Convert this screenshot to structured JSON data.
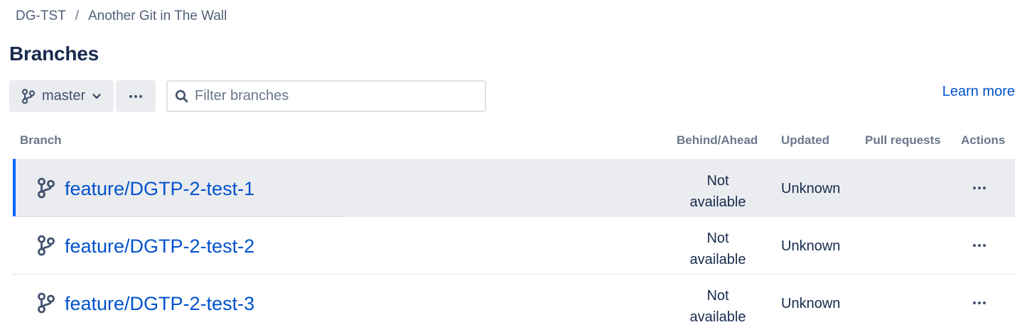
{
  "breadcrumb": {
    "project": "DG-TST",
    "separator": "/",
    "repository": "Another Git in The Wall"
  },
  "page": {
    "title": "Branches"
  },
  "toolbar": {
    "branch_selected": "master",
    "filter_placeholder": "Filter branches",
    "filter_value": "",
    "learn_more": "Learn more"
  },
  "table": {
    "headers": {
      "branch": "Branch",
      "behind_ahead": "Behind/Ahead",
      "updated": "Updated",
      "pull_requests": "Pull requests",
      "actions": "Actions"
    },
    "rows": [
      {
        "name": "feature/DGTP-2-test-1",
        "behind_line1": "Not",
        "behind_line2": "available",
        "updated": "Unknown",
        "pull_requests": ""
      },
      {
        "name": "feature/DGTP-2-test-2",
        "behind_line1": "Not",
        "behind_line2": "available",
        "updated": "Unknown",
        "pull_requests": ""
      },
      {
        "name": "feature/DGTP-2-test-3",
        "behind_line1": "Not",
        "behind_line2": "available",
        "updated": "Unknown",
        "pull_requests": ""
      }
    ]
  },
  "colors": {
    "link": "#0052cc",
    "selected_accent": "#0065ff",
    "selected_bg": "#ebecf0",
    "text": "#172b4d",
    "muted": "#6b778c"
  },
  "icons": {
    "branch": "git-branch-icon",
    "chevron": "chevron-down-icon",
    "more": "more-horizontal-icon",
    "search": "search-icon"
  }
}
